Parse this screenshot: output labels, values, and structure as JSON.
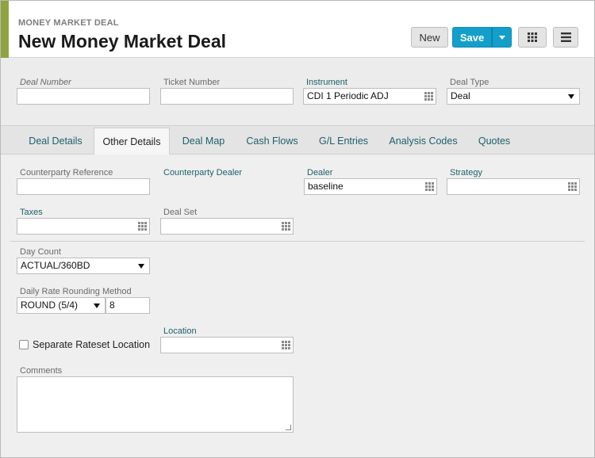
{
  "header": {
    "breadcrumb": "MONEY MARKET DEAL",
    "title": "New Money Market Deal",
    "new_label": "New",
    "save_label": "Save"
  },
  "colors": {
    "accent": "#8fa33f",
    "primary": "#139fc9",
    "link": "#1d5f6a"
  },
  "top_form": {
    "deal_number": {
      "label": "Deal Number",
      "value": ""
    },
    "ticket_number": {
      "label": "Ticket Number",
      "value": ""
    },
    "instrument": {
      "label": "Instrument",
      "value": "CDI 1 Periodic ADJ"
    },
    "deal_type": {
      "label": "Deal Type",
      "value": "Deal"
    }
  },
  "tabs": [
    {
      "label": "Deal Details"
    },
    {
      "label": "Other Details"
    },
    {
      "label": "Deal Map"
    },
    {
      "label": "Cash Flows"
    },
    {
      "label": "G/L Entries"
    },
    {
      "label": "Analysis Codes"
    },
    {
      "label": "Quotes"
    }
  ],
  "active_tab": "Other Details",
  "other_details": {
    "counterparty_reference": {
      "label": "Counterparty Reference",
      "value": ""
    },
    "counterparty_dealer": {
      "label": "Counterparty Dealer"
    },
    "dealer": {
      "label": "Dealer",
      "value": "baseline"
    },
    "strategy": {
      "label": "Strategy",
      "value": ""
    },
    "taxes": {
      "label": "Taxes",
      "value": ""
    },
    "deal_set": {
      "label": "Deal Set",
      "value": ""
    },
    "day_count": {
      "label": "Day Count",
      "value": "ACTUAL/360BD"
    },
    "daily_rate_rounding": {
      "label": "Daily Rate Rounding Method",
      "method": "ROUND (5/4)",
      "digits": "8"
    },
    "separate_rateset": {
      "label": "Separate Rateset Location",
      "checked": false
    },
    "location": {
      "label": "Location",
      "value": ""
    },
    "comments": {
      "label": "Comments",
      "value": ""
    }
  },
  "icons": [
    "grid-icon",
    "menu-icon",
    "caret-down-icon",
    "lookup-icon"
  ]
}
